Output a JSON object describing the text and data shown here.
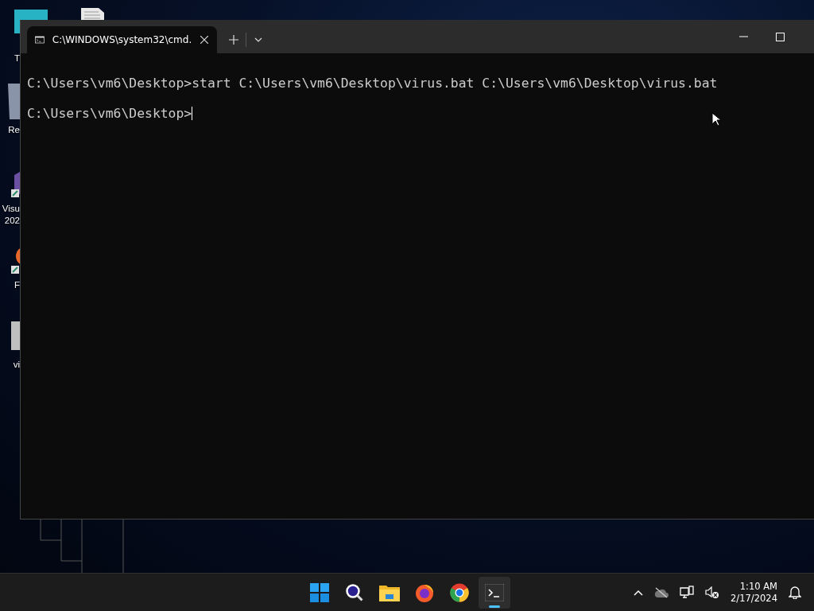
{
  "desktop_icons": [
    {
      "kind": "folder",
      "lines": [
        "T"
      ]
    },
    {
      "kind": "document"
    },
    {
      "kind": "recycle",
      "lines": [
        "Re"
      ]
    },
    {
      "kind": "studio",
      "lines": [
        "Visu",
        "202"
      ]
    },
    {
      "kind": "browser",
      "lines": [
        "F"
      ]
    },
    {
      "kind": "file",
      "lines": [
        "vi"
      ]
    }
  ],
  "terminal": {
    "tabs": [
      {
        "title": "C:\\WINDOWS\\system32\\cmd.",
        "selected": true
      }
    ],
    "lines": [
      "C:\\Users\\vm6\\Desktop>start C:\\Users\\vm6\\Desktop\\virus.bat C:\\Users\\vm6\\Desktop\\virus.bat",
      "C:\\Users\\vm6\\Desktop>"
    ]
  },
  "taskbar": {
    "apps": [
      {
        "kind": "start",
        "selected": false
      },
      {
        "kind": "search",
        "selected": false
      },
      {
        "kind": "files",
        "selected": false
      },
      {
        "kind": "firefox",
        "selected": false
      },
      {
        "kind": "chrome",
        "selected": false
      },
      {
        "kind": "terminal",
        "selected": true
      }
    ],
    "time": "1:10 AM",
    "date": "2/17/2024"
  }
}
